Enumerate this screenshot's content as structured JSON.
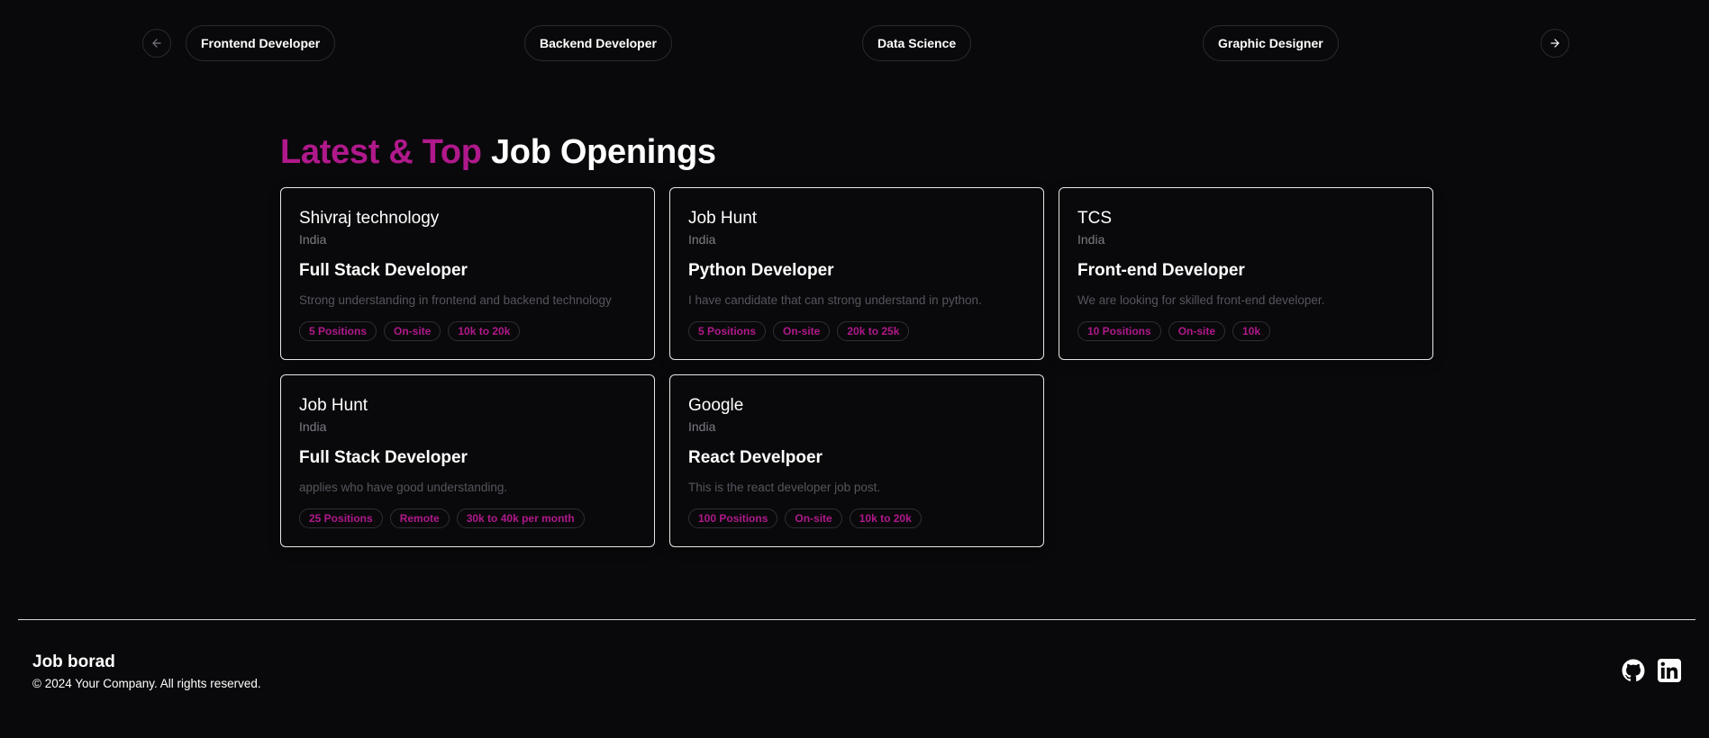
{
  "carousel": {
    "categories": [
      "Frontend Developer",
      "Backend Developer",
      "Data Science",
      "Graphic Designer"
    ],
    "prev_icon": "arrow-left-icon",
    "next_icon": "arrow-right-icon"
  },
  "section": {
    "title_accent": "Latest & Top",
    "title_rest": "Job Openings"
  },
  "jobs": [
    {
      "company": "Shivraj technology",
      "location": "India",
      "title": "Full Stack Developer",
      "description": "Strong understanding in frontend and backend technology",
      "positions": "5 Positions",
      "job_type": "On-site",
      "salary": "10k to 20k"
    },
    {
      "company": "Job Hunt",
      "location": "India",
      "title": "Python Developer",
      "description": "I have candidate that can strong understand in python.",
      "positions": "5 Positions",
      "job_type": "On-site",
      "salary": "20k to 25k"
    },
    {
      "company": "TCS",
      "location": "India",
      "title": "Front-end Developer",
      "description": "We are looking for skilled front-end developer.",
      "positions": "10 Positions",
      "job_type": "On-site",
      "salary": "10k"
    },
    {
      "company": "Job Hunt",
      "location": "India",
      "title": "Full Stack Developer",
      "description": "applies who have good understanding.",
      "positions": "25 Positions",
      "job_type": "Remote",
      "salary": "30k to 40k per month"
    },
    {
      "company": "Google",
      "location": "India",
      "title": "React Develpoer",
      "description": "This is the react developer job post.",
      "positions": "100 Positions",
      "job_type": "On-site",
      "salary": "10k to 20k"
    }
  ],
  "footer": {
    "brand": "Job borad",
    "copyright": "© 2024 Your Company. All rights reserved.",
    "social_icons": [
      "github-icon",
      "linkedin-icon"
    ]
  },
  "colors": {
    "background": "#09090b",
    "accent": "#b0198b",
    "text": "#ffffff",
    "muted": "#7c7c85"
  }
}
